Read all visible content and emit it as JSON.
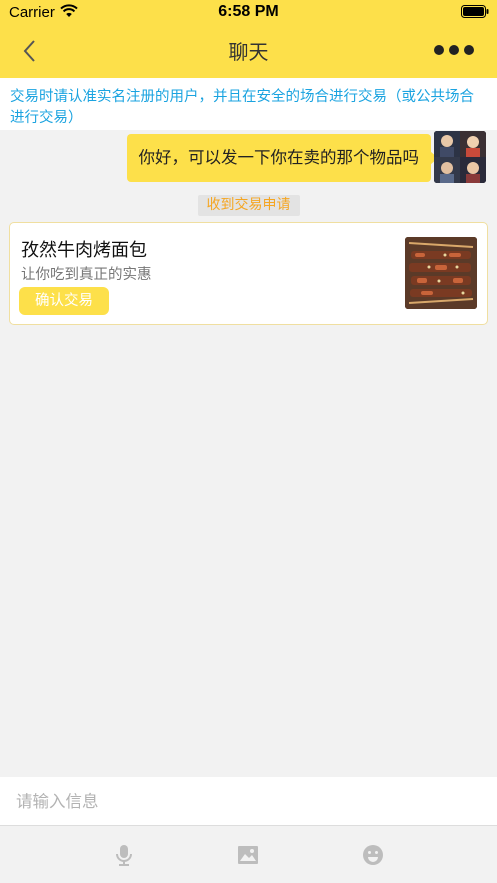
{
  "status_bar": {
    "carrier": "Carrier",
    "time": "6:58 PM"
  },
  "nav": {
    "title": "聊天",
    "back_icon": "chevron-left-icon",
    "more_icon": "more-dots-icon"
  },
  "notice": {
    "text": "交易时请认准实名注册的用户，并且在安全的场合进行交易（或公共场合进行交易）"
  },
  "messages": [
    {
      "side": "right",
      "text": "你好，可以发一下你在卖的那个物品吗"
    }
  ],
  "system_tip": "收到交易申请",
  "trade_card": {
    "title": "孜然牛肉烤面包",
    "subtitle": "让你吃到真正的实惠",
    "button": "确认交易"
  },
  "input": {
    "placeholder": "请输入信息"
  },
  "toolbar": {
    "icons": [
      "microphone-icon",
      "image-icon",
      "emoji-icon"
    ]
  },
  "colors": {
    "accent": "#fde04a",
    "notice_text": "#1aa3e0",
    "tip_text": "#f5a623"
  }
}
